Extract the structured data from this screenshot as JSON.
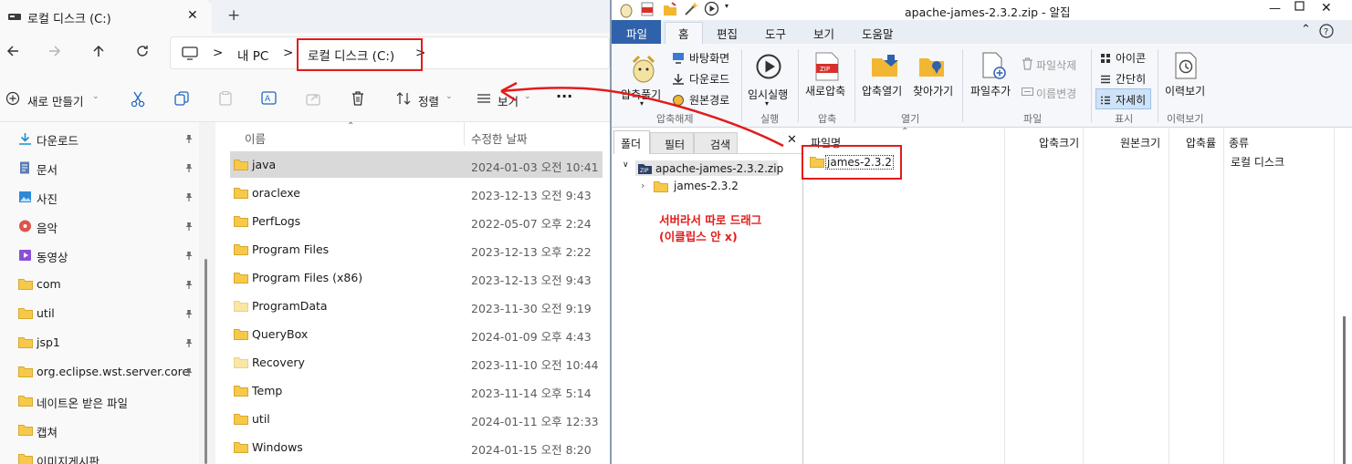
{
  "explorer": {
    "tab_title": "로컬 디스크 (C:)",
    "new_tab": "+",
    "breadcrumb": {
      "sep": ">",
      "pc": "내 PC",
      "current": "로컬 디스크 (C:)"
    },
    "commands": {
      "new": "새로 만들기",
      "sort": "정렬",
      "view": "보기",
      "more": "···"
    },
    "columns": {
      "name": "이름",
      "modified": "수정한 날짜"
    },
    "nav_items": [
      {
        "label": "다운로드",
        "icon": "download-icon",
        "pinned": true
      },
      {
        "label": "문서",
        "icon": "document-icon",
        "pinned": true
      },
      {
        "label": "사진",
        "icon": "picture-icon",
        "pinned": true
      },
      {
        "label": "음악",
        "icon": "music-icon",
        "pinned": true
      },
      {
        "label": "동영상",
        "icon": "video-icon",
        "pinned": true
      },
      {
        "label": "com",
        "icon": "folder-icon",
        "pinned": true
      },
      {
        "label": "util",
        "icon": "folder-icon",
        "pinned": true
      },
      {
        "label": "jsp1",
        "icon": "folder-icon",
        "pinned": true
      },
      {
        "label": "org.eclipse.wst.server.core",
        "icon": "folder-icon",
        "pinned": true
      },
      {
        "label": "네이트온 받은 파일",
        "icon": "folder-icon",
        "pinned": false
      },
      {
        "label": "캡쳐",
        "icon": "folder-icon",
        "pinned": false
      },
      {
        "label": "이미지게시판",
        "icon": "folder-icon",
        "pinned": false
      }
    ],
    "files": [
      {
        "name": "java",
        "date": "2024-01-03 오전 10:41",
        "selected": true
      },
      {
        "name": "oraclexe",
        "date": "2023-12-13 오전 9:43"
      },
      {
        "name": "PerfLogs",
        "date": "2022-05-07 오후 2:24"
      },
      {
        "name": "Program Files",
        "date": "2023-12-13 오후 2:22"
      },
      {
        "name": "Program Files (x86)",
        "date": "2023-12-13 오전 9:43"
      },
      {
        "name": "ProgramData",
        "date": "2023-11-30 오전 9:19",
        "faded": true
      },
      {
        "name": "QueryBox",
        "date": "2024-01-09 오후 4:43"
      },
      {
        "name": "Recovery",
        "date": "2023-11-10 오전 10:44",
        "faded": true
      },
      {
        "name": "Temp",
        "date": "2023-11-14 오후 5:14"
      },
      {
        "name": "util",
        "date": "2024-01-11 오후 12:33"
      },
      {
        "name": "Windows",
        "date": "2024-01-15 오전 8:20"
      }
    ]
  },
  "alzip": {
    "title": "apache-james-2.3.2.zip - 알집",
    "menu": [
      "파일",
      "홈",
      "편집",
      "도구",
      "보기",
      "도움말"
    ],
    "ribbon": {
      "extract": "압축풀기",
      "to_desktop": "바탕화면",
      "to_downloads": "다운로드",
      "to_original": "원본경로",
      "group_extract": "압축해제",
      "temp_run": "임시실행",
      "group_run": "실행",
      "new_zip": "새로압축",
      "group_compress": "압축",
      "open_zip": "압축열기",
      "find": "찾아가기",
      "group_open": "열기",
      "add_file": "파일추가",
      "delete_file": "파일삭제",
      "rename": "이름변경",
      "group_file": "파일",
      "view_icon": "아이콘",
      "view_simple": "간단히",
      "view_detail": "자세히",
      "group_view": "표시",
      "history": "이력보기",
      "group_history": "이력보기"
    },
    "left_tabs": [
      "폴더",
      "필터",
      "검색"
    ],
    "tree": {
      "root": "apache-james-2.3.2.zip",
      "child": "james-2.3.2"
    },
    "columns": {
      "name": "파일명",
      "packed": "압축크기",
      "original": "원본크기",
      "ratio": "압축률",
      "type": "종류"
    },
    "rows": [
      {
        "name": "james-2.3.2",
        "type": "로컬 디스크"
      }
    ]
  },
  "annotation": {
    "line1": "서버라서 따로 드래그",
    "line2": "(이클립스 안 x)",
    "color": "#e31b1b"
  }
}
